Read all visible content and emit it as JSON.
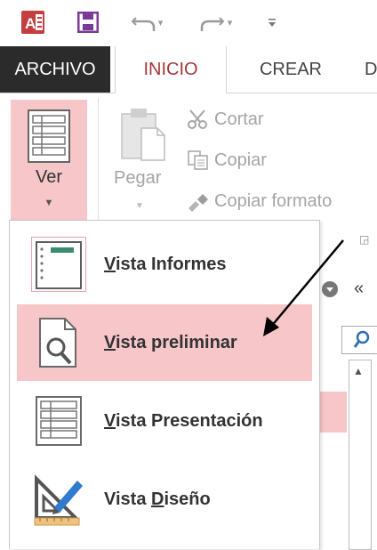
{
  "quick_access": {
    "app_icon": "access-logo-icon",
    "save_icon": "save-icon",
    "undo_icon": "undo-icon",
    "redo_icon": "redo-icon",
    "customize_icon": "customize-toolbar-icon"
  },
  "tabs": [
    {
      "label": "ARCHIVO"
    },
    {
      "label": "INICIO",
      "active": true
    },
    {
      "label": "CREAR"
    },
    {
      "label": "D"
    }
  ],
  "ribbon": {
    "ver_label": "Ver",
    "pegar_label": "Pegar",
    "cortar_label": "Cortar",
    "copiar_label": "Copiar",
    "copiar_formato_label": "Copiar formato"
  },
  "navigation_pane": {
    "collapse_glyph": "«"
  },
  "ver_menu": {
    "items": [
      {
        "pre": "",
        "underlined": "V",
        "post": "ista Informes",
        "icon": "report-view-icon",
        "highlighted": false
      },
      {
        "pre": "",
        "underlined": "V",
        "post": "ista preliminar",
        "icon": "print-preview-icon",
        "highlighted": true
      },
      {
        "pre": "",
        "underlined": "V",
        "post": "ista Presentación",
        "icon": "layout-view-icon",
        "highlighted": false
      },
      {
        "pre": "Vista ",
        "underlined": "D",
        "post": "iseño",
        "icon": "design-view-icon",
        "highlighted": false
      }
    ]
  },
  "colors": {
    "accent": "#a4373a",
    "highlight": "#f6c6c8",
    "file_tab_bg": "#2b2b2b",
    "access_red": "#c43e3e",
    "save_purple": "#7b3a96"
  }
}
